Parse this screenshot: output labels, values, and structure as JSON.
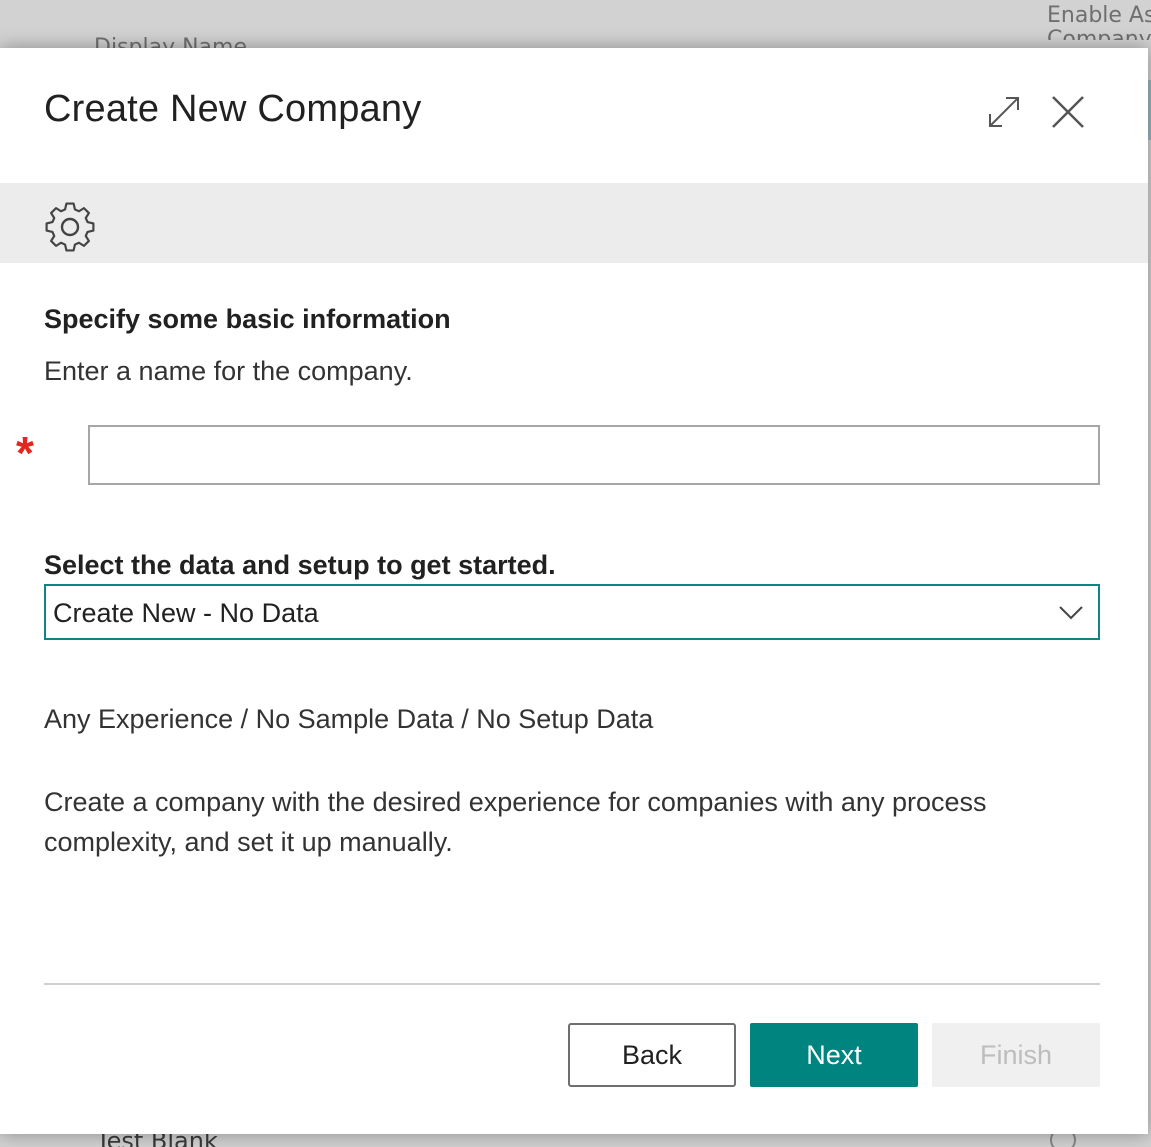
{
  "background": {
    "header_right_line1": "Enable As",
    "header_right_line2": "Company",
    "header_left": "Display Name",
    "row_bottom": "Test Blank"
  },
  "dialog": {
    "title": "Create New Company",
    "section_heading": "Specify some basic information",
    "instruction": "Enter a name for the company.",
    "required_marker": "*",
    "company_name_value": "",
    "select_label": "Select the data and setup to get started.",
    "select_value": "Create New - No Data",
    "subtitle": "Any Experience / No Sample Data / No Setup Data",
    "description": "Create a company with the desired experience for companies with any process complexity, and set it up manually."
  },
  "buttons": {
    "back": "Back",
    "next": "Next",
    "finish": "Finish"
  },
  "icons": {
    "expand": "expand-icon",
    "close": "close-icon",
    "settings": "gear-icon",
    "dropdown": "chevron-down-icon"
  },
  "colors": {
    "accent": "#00847f",
    "required": "#e0281e",
    "toolbar_bg": "#ececec"
  }
}
